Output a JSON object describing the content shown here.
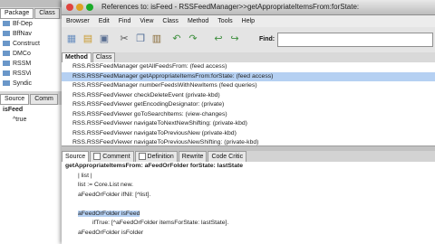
{
  "back_window": {
    "tabs": [
      "Package",
      "Class"
    ],
    "tree_items": [
      "Bf-Dep",
      "BffNav",
      "Construct",
      "DMCo",
      "RSSM",
      "RSSVi",
      "Syndic"
    ],
    "detail_tabs": [
      "Source",
      "Comm"
    ],
    "detail_heading": "isFeed",
    "detail_line": "^true"
  },
  "window": {
    "title": "References to: isFeed - RSSFeedManager>>getAppropriateItemsFrom:forState:",
    "colors": {
      "close": "#e0443e",
      "minimize": "#dea123",
      "zoom": "#1aab29"
    }
  },
  "menu": [
    "Browser",
    "Edit",
    "Find",
    "View",
    "Class",
    "Method",
    "Tools",
    "Help"
  ],
  "toolbar": {
    "icons": [
      "new-browser-icon",
      "open-icon",
      "save-icon",
      "cut-icon",
      "copy-icon",
      "paste-icon",
      "undo-icon",
      "redo-icon",
      "back-icon",
      "forward-icon"
    ],
    "find_label": "Find:",
    "find_value": ""
  },
  "list_tabs": [
    "Method",
    "Class"
  ],
  "references": [
    "RSS.RSSFeedManager getAllFeedsFrom: (feed access)",
    "RSS.RSSFeedManager getAppropriateItemsFrom:forState: (feed access)",
    "RSS.RSSFeedManager numberFeedsWithNewItems (feed queries)",
    "RSS.RSSFeedViewer checkDeleteEvent (private-kbd)",
    "RSS.RSSFeedViewer getEncodingDesignator: (private)",
    "RSS.RSSFeedViewer goToSearchItems: (view-changes)",
    "RSS.RSSFeedViewer navigateToNextNewShifting: (private-kbd)",
    "RSS.RSSFeedViewer navigateToPreviousNew (private-kbd)",
    "RSS.RSSFeedViewer navigateToPreviousNewShifting: (private-kbd)"
  ],
  "selected_reference_index": 1,
  "code_tabs": [
    "Source",
    "Comment",
    "Definition",
    "Rewrite",
    "Code Critic"
  ],
  "code": {
    "signature": "getAppropriateItemsFrom: aFeedOrFolder forState: lastState",
    "lines": [
      "| list |",
      "list := Core.List new.",
      "aFeedOrFolder ifNil: [^list].",
      "",
      "aFeedOrFolder isFeed",
      "ifTrue: [^aFeedOrFolder itemsForState: lastState].",
      "aFeedOrFolder isFolder"
    ],
    "highlight_line": 4
  }
}
